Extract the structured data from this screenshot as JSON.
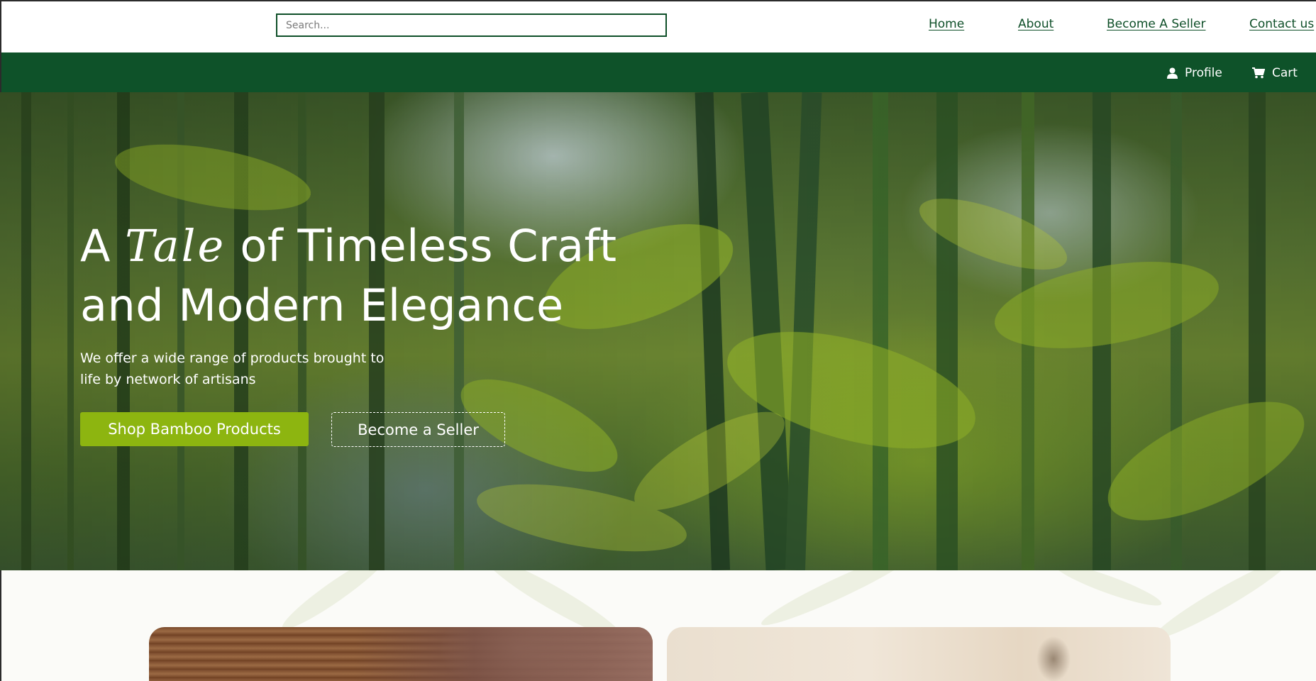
{
  "search": {
    "placeholder": "Search..."
  },
  "nav": {
    "links": [
      {
        "label": "Home"
      },
      {
        "label": "About"
      },
      {
        "label": "Become A Seller"
      },
      {
        "label": "Contact us"
      }
    ]
  },
  "toolbar": {
    "profile_label": "Profile",
    "profile_icon": "user-icon",
    "cart_label": "Cart",
    "cart_icon": "cart-icon"
  },
  "hero": {
    "title_prefix": "A",
    "title_script": "Tale",
    "title_rest_line1": "of Timeless Craft",
    "title_line2": "and Modern Elegance",
    "subtitle": "We offer a wide range of products brought to life by network of artisans",
    "primary_button": "Shop Bamboo Products",
    "secondary_button": "Become a Seller"
  },
  "colors": {
    "brand_green": "#0e5229",
    "accent_lime": "#8db510",
    "link_green": "#0e4f28"
  }
}
